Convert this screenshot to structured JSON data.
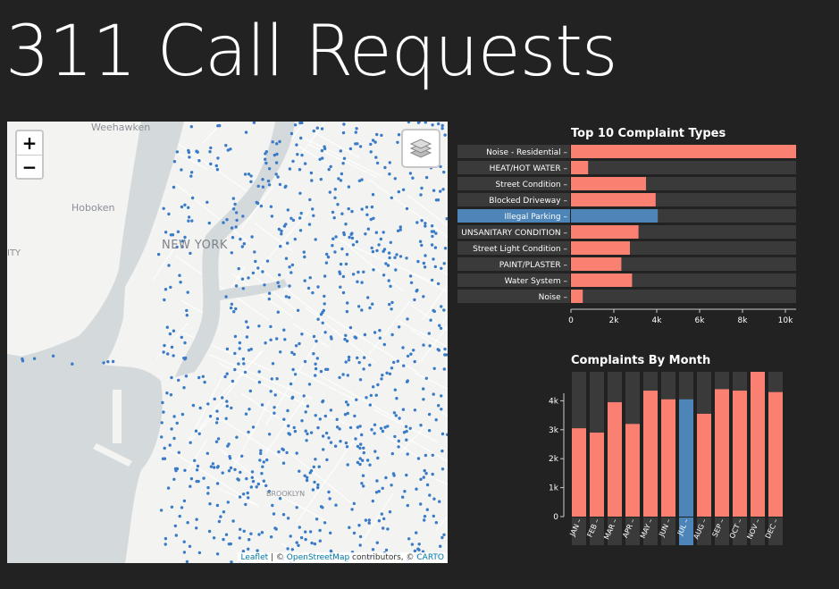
{
  "page": {
    "title": "311 Call Requests"
  },
  "map": {
    "zoom_in_label": "+",
    "zoom_out_label": "−",
    "place_labels": {
      "weehawken": "Weehawken",
      "hoboken": "Hoboken",
      "new_york": "NEW YORK",
      "city": "ITY",
      "brooklyn": "BROOKLYN"
    },
    "attribution": {
      "leaflet": "Leaflet",
      "sep": " | © ",
      "osm": "OpenStreetMap",
      "contributors": " contributors, © ",
      "carto": "CARTO"
    },
    "colors": {
      "land": "#f3f3f1",
      "water": "#d4dadc",
      "street": "#ffffff",
      "point": "#3a7bc8"
    },
    "icons": [
      "layers-icon"
    ]
  },
  "colors": {
    "bar": "#fa8072",
    "selected": "#4e85b8",
    "track": "#3a3a3a"
  },
  "chart_data": [
    {
      "type": "bar",
      "orientation": "horizontal",
      "title": "Top 10 Complaint Types",
      "categories": [
        "Noise - Residential",
        "HEAT/HOT WATER",
        "Street Condition",
        "Blocked Driveway",
        "Illegal Parking",
        "UNSANITARY CONDITION",
        "Street Light Condition",
        "PAINT/PLASTER",
        "Water System",
        "Noise"
      ],
      "values": [
        10500,
        800,
        3500,
        3950,
        4050,
        3150,
        2750,
        2350,
        2850,
        550
      ],
      "selected": "Illegal Parking",
      "xlim": [
        0,
        10500
      ],
      "xticks": [
        0,
        2000,
        4000,
        6000,
        8000,
        10000
      ],
      "xtick_labels": [
        "0",
        "2k",
        "4k",
        "6k",
        "8k",
        "10k"
      ]
    },
    {
      "type": "bar",
      "title": "Complaints By Month",
      "categories": [
        "JAN",
        "FEB",
        "MAR",
        "APR",
        "MAY",
        "JUN",
        "JUL",
        "AUG",
        "SEP",
        "OCT",
        "NOV",
        "DEC"
      ],
      "values": [
        3050,
        2900,
        3950,
        3200,
        4350,
        4050,
        4050,
        3550,
        4400,
        4350,
        5000,
        4300
      ],
      "selected": "JUL",
      "ylim": [
        0,
        5000
      ],
      "yticks": [
        0,
        1000,
        2000,
        3000,
        4000
      ],
      "ytick_labels": [
        "0",
        "1k",
        "2k",
        "3k",
        "4k"
      ]
    }
  ]
}
